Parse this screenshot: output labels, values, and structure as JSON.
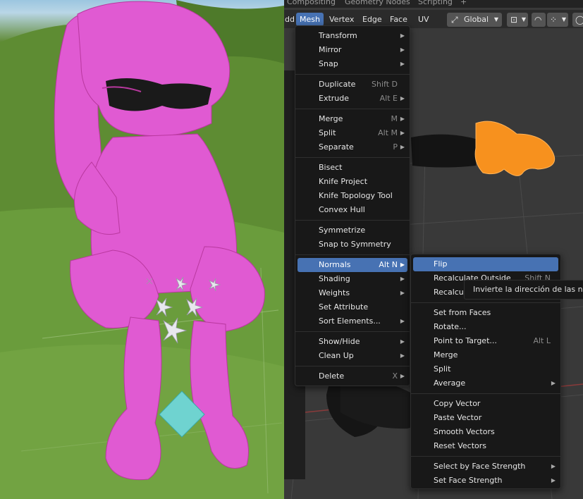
{
  "workspace_tabs": [
    "Compositing",
    "Geometry Nodes",
    "Scripting",
    "+"
  ],
  "header": {
    "menus": [
      {
        "label": "dd"
      },
      {
        "label": "Mesh",
        "active": true
      },
      {
        "label": "Vertex"
      },
      {
        "label": "Edge"
      },
      {
        "label": "Face"
      },
      {
        "label": "UV"
      }
    ],
    "orientation": "Global"
  },
  "mesh_menu": {
    "items": [
      {
        "label": "Transform",
        "shortcut": "",
        "submenu": true
      },
      {
        "label": "Mirror",
        "shortcut": "",
        "submenu": true
      },
      {
        "label": "Snap",
        "shortcut": "",
        "submenu": true
      },
      {
        "label": "Duplicate",
        "shortcut": "Shift D",
        "submenu": false
      },
      {
        "label": "Extrude",
        "shortcut": "Alt E",
        "submenu": true
      },
      {
        "label": "Merge",
        "shortcut": "M",
        "submenu": true
      },
      {
        "label": "Split",
        "shortcut": "Alt M",
        "submenu": true
      },
      {
        "label": "Separate",
        "shortcut": "P",
        "submenu": true
      },
      {
        "label": "Bisect",
        "shortcut": "",
        "submenu": false
      },
      {
        "label": "Knife Project",
        "shortcut": "",
        "submenu": false
      },
      {
        "label": "Knife Topology Tool",
        "shortcut": "",
        "submenu": false
      },
      {
        "label": "Convex Hull",
        "shortcut": "",
        "submenu": false
      },
      {
        "label": "Symmetrize",
        "shortcut": "",
        "submenu": false
      },
      {
        "label": "Snap to Symmetry",
        "shortcut": "",
        "submenu": false
      },
      {
        "label": "Normals",
        "shortcut": "Alt N",
        "submenu": true,
        "highlighted": true
      },
      {
        "label": "Shading",
        "shortcut": "",
        "submenu": true
      },
      {
        "label": "Weights",
        "shortcut": "",
        "submenu": true
      },
      {
        "label": "Set Attribute",
        "shortcut": "",
        "submenu": false
      },
      {
        "label": "Sort Elements...",
        "shortcut": "",
        "submenu": true
      },
      {
        "label": "Show/Hide",
        "shortcut": "",
        "submenu": true
      },
      {
        "label": "Clean Up",
        "shortcut": "",
        "submenu": true
      },
      {
        "label": "Delete",
        "shortcut": "X",
        "submenu": true
      }
    ]
  },
  "normals_menu": {
    "items": [
      {
        "label": "Flip",
        "shortcut": "",
        "submenu": false,
        "highlighted": true
      },
      {
        "label": "Recalculate Outside",
        "shortcut": "Shift N",
        "submenu": false
      },
      {
        "label": "Recalculate Inside",
        "shortcut": "",
        "submenu": false
      },
      {
        "label": "Set from Faces",
        "shortcut": "",
        "submenu": false
      },
      {
        "label": "Rotate...",
        "shortcut": "",
        "submenu": false
      },
      {
        "label": "Point to Target...",
        "shortcut": "Alt L",
        "submenu": false
      },
      {
        "label": "Merge",
        "shortcut": "",
        "submenu": false
      },
      {
        "label": "Split",
        "shortcut": "",
        "submenu": false
      },
      {
        "label": "Average",
        "shortcut": "",
        "submenu": true
      },
      {
        "label": "Copy Vector",
        "shortcut": "",
        "submenu": false
      },
      {
        "label": "Paste Vector",
        "shortcut": "",
        "submenu": false
      },
      {
        "label": "Smooth Vectors",
        "shortcut": "",
        "submenu": false
      },
      {
        "label": "Reset Vectors",
        "shortcut": "",
        "submenu": false
      },
      {
        "label": "Select by Face Strength",
        "shortcut": "",
        "submenu": true
      },
      {
        "label": "Set Face Strength",
        "shortcut": "",
        "submenu": true
      }
    ]
  },
  "tooltip": {
    "text": "Invierte la dirección de las normales"
  },
  "colors": {
    "accent": "#4772b3",
    "menu_bg": "#181818",
    "character_pink": "#e05ad2",
    "mesh_orange": "#f7911e"
  }
}
